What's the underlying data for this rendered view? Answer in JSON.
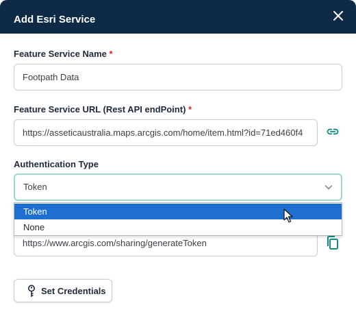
{
  "dialog": {
    "title": "Add Esri Service",
    "close_icon": "close-icon"
  },
  "form": {
    "service_name": {
      "label": "Feature Service Name",
      "required_mark": "*",
      "value": "Footpath Data"
    },
    "service_url": {
      "label": "Feature Service URL (Rest API endPoint)",
      "required_mark": "*",
      "value": "https://asseticaustralia.maps.arcgis.com/home/item.html?id=71ed460f4",
      "link_icon": "link-icon"
    },
    "auth_type": {
      "label": "Authentication Type",
      "selected": "Token",
      "options": [
        "Token",
        "None"
      ],
      "highlighted_option": "Token"
    },
    "token_url": {
      "value": "https://www.arcgis.com/sharing/generateToken",
      "copy_icon": "copy-icon"
    },
    "set_credentials_button": {
      "label": "Set Credentials",
      "icon": "key-icon"
    }
  },
  "colors": {
    "header_bg": "#0f2a47",
    "accent_teal": "#0f8f86",
    "required_red": "#d62828",
    "selected_option_bg": "#1f6fd1",
    "focus_border": "#9ed8d0"
  }
}
